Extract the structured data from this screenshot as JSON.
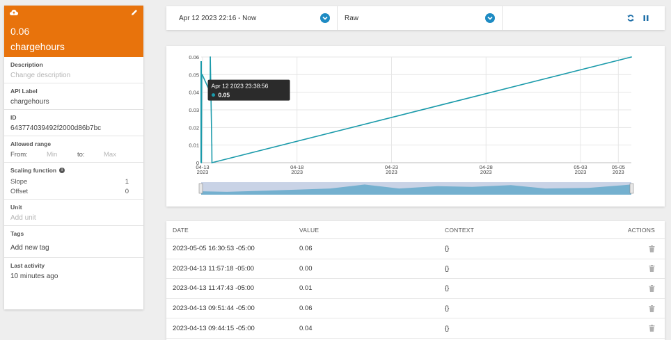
{
  "variable": {
    "value": "0.06",
    "name": "chargehours",
    "header_color": "#e8730c",
    "icons": {
      "status": "cloud-icon",
      "edit": "pencil-icon"
    }
  },
  "fields": {
    "description": {
      "label": "Description",
      "placeholder": "Change description"
    },
    "api_label": {
      "label": "API Label",
      "value": "chargehours"
    },
    "id": {
      "label": "ID",
      "value": "643774039492f2000d86b7bc"
    },
    "allowed_range": {
      "label": "Allowed range",
      "from_label": "From:",
      "min_placeholder": "Min",
      "to_label": "to:",
      "max_placeholder": "Max"
    },
    "scaling": {
      "label": "Scaling function",
      "slope_label": "Slope",
      "slope_value": "1",
      "offset_label": "Offset",
      "offset_value": "0"
    },
    "unit": {
      "label": "Unit",
      "placeholder": "Add unit"
    },
    "tags": {
      "label": "Tags",
      "add_label": "Add new tag"
    },
    "last_activity": {
      "label": "Last activity",
      "value": "10 minutes ago"
    }
  },
  "toolbar": {
    "date_range": "Apr 12 2023 22:16 - Now",
    "mode": "Raw",
    "accent": "#1e8bc3"
  },
  "chart_data": {
    "type": "line",
    "series": [
      {
        "color": "#1a9aaa",
        "points": [
          [
            "2023-04-12T22:16",
            0.05
          ],
          [
            "2023-04-12T22:30",
            0.0
          ],
          [
            "2023-04-12T23:00",
            0.05
          ],
          [
            "2023-04-12T23:38",
            0.05
          ],
          [
            "2023-04-13T09:44",
            0.04
          ],
          [
            "2023-04-13T09:51",
            0.06
          ],
          [
            "2023-04-13T11:47",
            0.01
          ],
          [
            "2023-04-13T11:57",
            0.0
          ],
          [
            "2023-05-05T16:30",
            0.06
          ]
        ]
      }
    ],
    "y_ticks": [
      "0",
      "0.01",
      "0.02",
      "0.03",
      "0.04",
      "0.05",
      "0.06"
    ],
    "x_ticks": [
      {
        "date": "2023-04-13",
        "label1": "04-13",
        "label2": "2023"
      },
      {
        "date": "2023-04-18",
        "label1": "04-18",
        "label2": "2023"
      },
      {
        "date": "2023-04-23",
        "label1": "04-23",
        "label2": "2023"
      },
      {
        "date": "2023-04-28",
        "label1": "04-28",
        "label2": "2023"
      },
      {
        "date": "2023-05-03",
        "label1": "05-03",
        "label2": "2023"
      },
      {
        "date": "2023-05-05",
        "label1": "05-05",
        "label2": "2023"
      }
    ],
    "ylim": [
      0,
      0.06
    ],
    "xlim": [
      "2023-04-12T22:16",
      "2023-05-05T16:30"
    ],
    "grid": true,
    "tooltip": {
      "date": "Apr 12 2023 23:38:56",
      "value": "0.05"
    }
  },
  "table": {
    "headers": [
      "DATE",
      "VALUE",
      "CONTEXT",
      "ACTIONS"
    ],
    "rows": [
      {
        "date": "2023-05-05 16:30:53 -05:00",
        "value": "0.06",
        "context": "{}"
      },
      {
        "date": "2023-04-13 11:57:18 -05:00",
        "value": "0.00",
        "context": "{}"
      },
      {
        "date": "2023-04-13 11:47:43 -05:00",
        "value": "0.01",
        "context": "{}"
      },
      {
        "date": "2023-04-13 09:51:44 -05:00",
        "value": "0.06",
        "context": "{}"
      },
      {
        "date": "2023-04-13 09:44:15 -05:00",
        "value": "0.04",
        "context": "{}"
      }
    ]
  }
}
